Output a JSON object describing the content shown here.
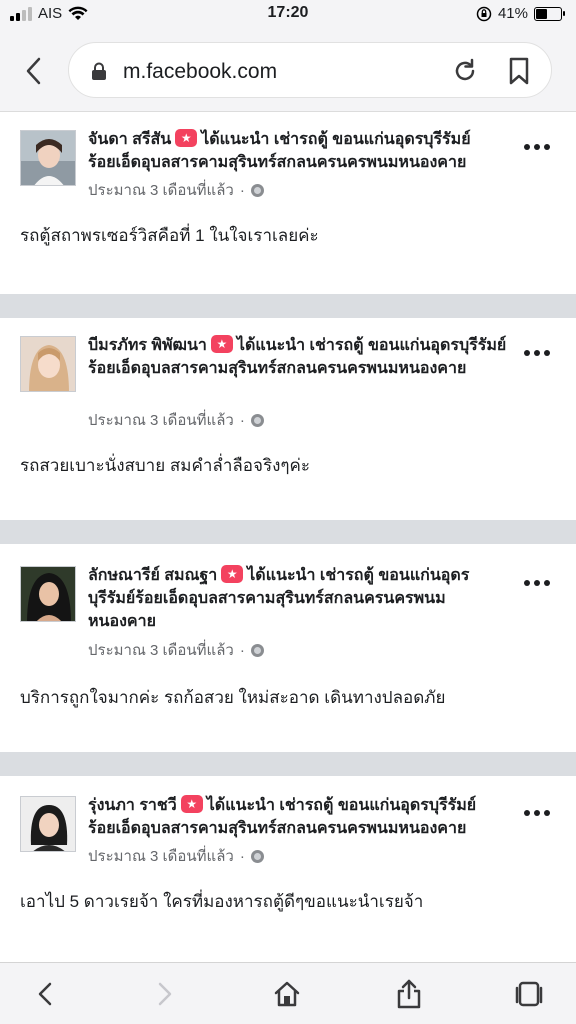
{
  "status_bar": {
    "carrier": "AIS",
    "time": "17:20",
    "battery_percent": "41%",
    "battery_level": 0.41,
    "icons": [
      "signal-icon",
      "wifi-icon",
      "orientation-lock-icon",
      "battery-icon"
    ]
  },
  "browser": {
    "url": "m.facebook.com",
    "icons": [
      "back-chevron-icon",
      "lock-icon",
      "reload-icon",
      "bookmark-icon"
    ]
  },
  "posts": [
    {
      "name": "จันดา สรีสัน",
      "header_text": "ได้แนะนำ เช่ารถตู้ ขอนแก่นอุดรบุรีรัมย์ร้อยเอ็ดอุบลสารคามสุรินทร์สกลนครนครพนมหนองคาย",
      "time": "ประมาณ 3 เดือนที่แล้ว",
      "separator": "·",
      "body": "รถตู้สถาพรเซอร์วิสคือที่ 1 ในใจเราเลยค่ะ"
    },
    {
      "name": "บีมรภัทร พิพัฒนา",
      "header_text": "ได้แนะนำ เช่ารถตู้ ขอนแก่นอุดรบุรีรัมย์ร้อยเอ็ดอุบลสารคามสุรินทร์สกลนครนครพนมหนองคาย",
      "time": "ประมาณ 3 เดือนที่แล้ว",
      "separator": "·",
      "body": "รถสวยเบาะนั่งสบาย สมคำล่ำลือจริงๆค่ะ"
    },
    {
      "name": "ลักษณารีย์ สมณฐา",
      "header_text": "ได้แนะนำ เช่ารถตู้ ขอนแก่นอุดรบุรีรัมย์ร้อยเอ็ดอุบลสารคามสุรินทร์สกลนครนครพนมหนองคาย",
      "time": "ประมาณ 3 เดือนที่แล้ว",
      "separator": "·",
      "body": "บริการถูกใจมากค่ะ รถก้อสวย ใหม่สะอาด เดินทางปลอดภัย"
    },
    {
      "name": "รุ่งนภา ราชวี",
      "header_text": "ได้แนะนำ เช่ารถตู้ ขอนแก่นอุดรบุรีรัมย์ร้อยเอ็ดอุบลสารคามสุรินทร์สกลนครนครพนมหนองคาย",
      "time": "ประมาณ 3 เดือนที่แล้ว",
      "separator": "·",
      "body": "เอาไป 5 ดาวเรยจ้า ใครที่มองหารถตู้ดีๆขอแนะนำเรยจ้า"
    }
  ],
  "toolbar": {
    "icons": [
      "back-arrow-icon",
      "forward-arrow-icon",
      "home-icon",
      "share-icon",
      "tabs-icon"
    ]
  },
  "colors": {
    "recommend_badge": "#f3425f",
    "meta_text": "#65676b",
    "divider": "#dadde1"
  }
}
